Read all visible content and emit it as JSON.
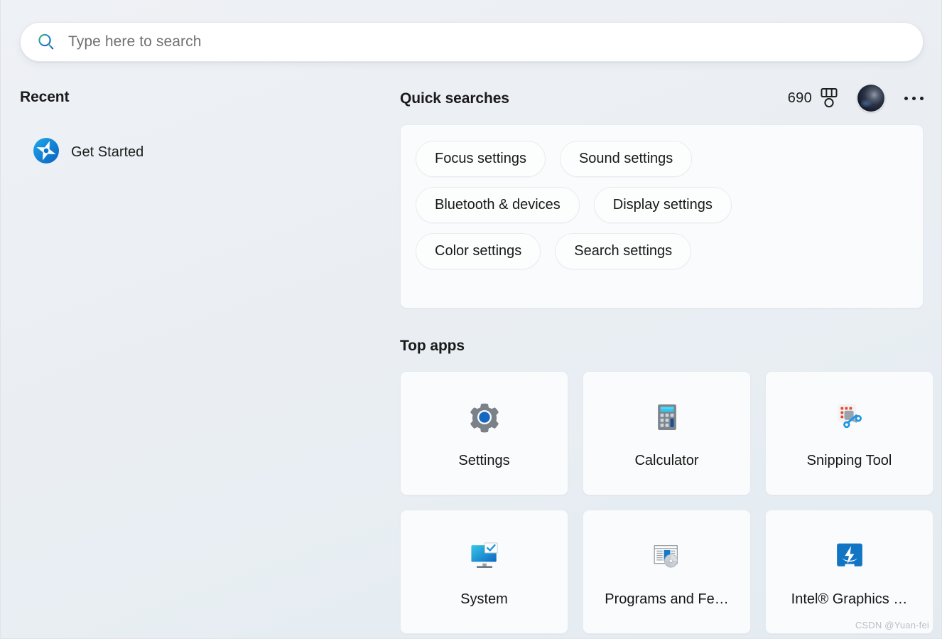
{
  "search": {
    "placeholder": "Type here to search",
    "icon": "search-icon"
  },
  "recent": {
    "title": "Recent",
    "items": [
      {
        "label": "Get Started",
        "icon": "get-started-icon"
      }
    ]
  },
  "quick_searches": {
    "title": "Quick searches",
    "chips": [
      {
        "label": "Focus settings"
      },
      {
        "label": "Sound settings"
      },
      {
        "label": "Bluetooth & devices"
      },
      {
        "label": "Display settings"
      },
      {
        "label": "Color settings"
      },
      {
        "label": "Search settings"
      }
    ]
  },
  "header_right": {
    "score": "690",
    "medal_icon": "medal-icon",
    "avatar": "user-avatar",
    "more_label": "more-options-icon"
  },
  "top_apps": {
    "title": "Top apps",
    "apps": [
      {
        "label": "Settings",
        "icon": "settings-gear-icon"
      },
      {
        "label": "Calculator",
        "icon": "calculator-icon"
      },
      {
        "label": "Snipping Tool",
        "icon": "snipping-tool-icon"
      },
      {
        "label": "System",
        "icon": "system-monitor-icon"
      },
      {
        "label": "Programs and Fe…",
        "icon": "programs-and-features-icon"
      },
      {
        "label": "Intel® Graphics …",
        "icon": "intel-graphics-icon"
      }
    ]
  },
  "watermark": {
    "text": "CSDN @Yuan-fei"
  },
  "colors": {
    "accent_blue": "#0c6bc4",
    "search_icon_green": "#2fb14e",
    "search_icon_blue": "#1a62c4",
    "card_bg": "#fafbfc",
    "card_border": "#e6eaee",
    "snip_orange": "#e8442a",
    "calc_cyan": "#33c6f0",
    "text_primary": "#1b1b1b",
    "text_placeholder": "#707070"
  }
}
